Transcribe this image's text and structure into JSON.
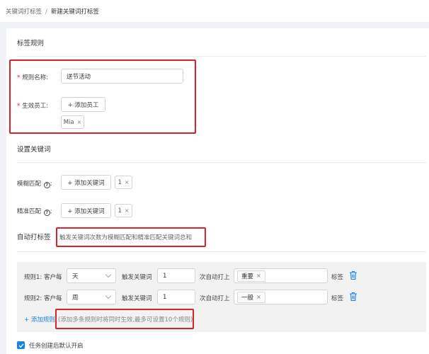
{
  "breadcrumb": {
    "parent": "关键词打标签",
    "separator": "/",
    "current": "新建关键词打标签"
  },
  "section_tag_rule": {
    "title": "标签规则"
  },
  "rule_name": {
    "label": "规则名称:",
    "value": "送节活动"
  },
  "employees": {
    "label": "生效员工:",
    "add_button": "+ 添加员工",
    "chips": [
      "Mia"
    ]
  },
  "section_keywords": {
    "title": "设置关键词"
  },
  "fuzzy": {
    "label": "模糊匹配",
    "add_button": "+ 添加关键词",
    "count": "1"
  },
  "exact": {
    "label": "精准匹配",
    "add_button": "+ 添加关键词",
    "count": "1"
  },
  "auto_tag": {
    "title": "自动打标签",
    "description": "触发关键词次数为模糊匹配和精准匹配关键词总和"
  },
  "rules": [
    {
      "prefix": "规则1:",
      "per_customer": "客户每",
      "period": "天",
      "trigger_label": "触发关键词",
      "times": "1",
      "auto_label": "次自动打上",
      "tag": "重要",
      "tag_suffix": "标签"
    },
    {
      "prefix": "规则2:",
      "per_customer": "客户每",
      "period": "周",
      "trigger_label": "触发关键词",
      "times": "1",
      "auto_label": "次自动打上",
      "tag": "一般",
      "tag_suffix": "标签"
    }
  ],
  "add_rule": {
    "label": "+ 添加规则",
    "hint": "(添加多条规则时将同时生效,最多可设置10个规则)"
  },
  "default_enable": {
    "label": "任务创建后默认开启",
    "checked": true
  },
  "colors": {
    "accent": "#1a82e3",
    "highlight": "#d9232b",
    "required": "#e02020"
  },
  "icons": {
    "required": "asterisk",
    "help": "question-circle-icon",
    "delete": "trash-icon",
    "dropdown": "chevron-down-icon",
    "remove": "close-icon",
    "checkbox": "check-icon"
  }
}
